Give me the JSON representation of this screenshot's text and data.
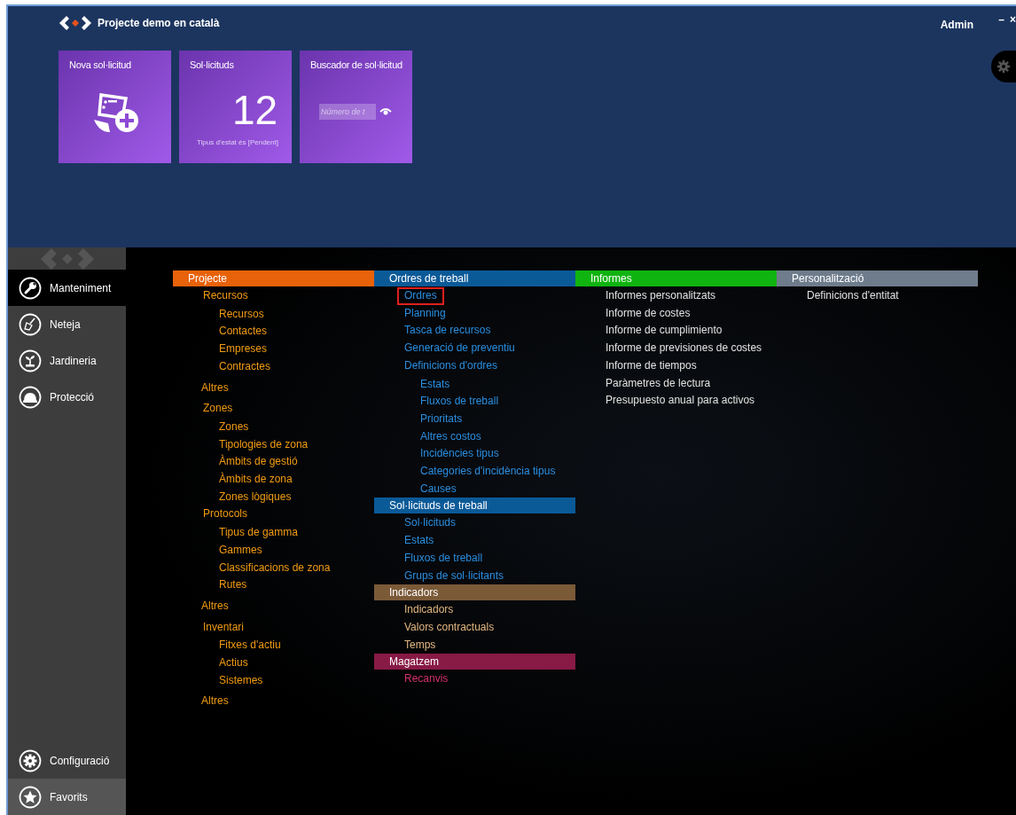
{
  "header": {
    "title": "Projecte demo en català",
    "user": "Admin",
    "window_controls": [
      "–",
      "×"
    ]
  },
  "tiles": [
    {
      "kind": "action",
      "title": "Nova sol·licitud"
    },
    {
      "kind": "counter",
      "title": "Sol·licituds",
      "count": "12",
      "caption": "Tipus d'estat és [Pendent]"
    },
    {
      "kind": "search",
      "title": "Buscador de sol·licitud",
      "placeholder": "Número de t"
    }
  ],
  "sidebar": {
    "items": [
      {
        "label": "Manteniment",
        "selected": true
      },
      {
        "label": "Neteja",
        "selected": false
      },
      {
        "label": "Jardineria",
        "selected": false
      },
      {
        "label": "Protecció",
        "selected": false
      }
    ],
    "bottom_items": [
      {
        "label": "Configuració",
        "hovered": false
      },
      {
        "label": "Favorits",
        "hovered": true
      }
    ]
  },
  "menu_columns": [
    {
      "sections": [
        {
          "title": "Projecte",
          "color": "#e8620a",
          "kind": "project",
          "items": [
            {
              "label": "Recursos",
              "kind": "link",
              "selected": false,
              "children": [
                {
                  "label": "Recursos",
                  "kind": "link",
                  "selected": false
                },
                {
                  "label": "Contactes",
                  "kind": "link",
                  "selected": false
                },
                {
                  "label": "Empreses",
                  "kind": "link",
                  "selected": false
                },
                {
                  "label": "Contractes",
                  "kind": "link",
                  "selected": false
                },
                {
                  "label": "Altres",
                  "kind": "more",
                  "selected": false
                }
              ]
            },
            {
              "label": "Zones",
              "kind": "link",
              "selected": false,
              "children": [
                {
                  "label": "Zones",
                  "kind": "link",
                  "selected": false
                },
                {
                  "label": "Tipologies de zona",
                  "kind": "link",
                  "selected": false
                },
                {
                  "label": "Àmbits de gestió",
                  "kind": "link",
                  "selected": false
                },
                {
                  "label": "Àmbits de zona",
                  "kind": "link",
                  "selected": false
                },
                {
                  "label": "Zones lògiques",
                  "kind": "link",
                  "selected": false
                }
              ]
            },
            {
              "label": "Protocols",
              "kind": "link",
              "selected": false,
              "children": [
                {
                  "label": "Tipus de gamma",
                  "kind": "link",
                  "selected": false
                },
                {
                  "label": "Gammes",
                  "kind": "link",
                  "selected": false
                },
                {
                  "label": "Classificacions de zona",
                  "kind": "link",
                  "selected": false
                },
                {
                  "label": "Rutes",
                  "kind": "link",
                  "selected": false
                },
                {
                  "label": "Altres",
                  "kind": "more",
                  "selected": false
                }
              ]
            },
            {
              "label": "Inventari",
              "kind": "link",
              "selected": false,
              "children": [
                {
                  "label": "Fitxes d'actiu",
                  "kind": "link",
                  "selected": false
                },
                {
                  "label": "Actius",
                  "kind": "link",
                  "selected": false
                },
                {
                  "label": "Sistemes",
                  "kind": "link",
                  "selected": false
                },
                {
                  "label": "Altres",
                  "kind": "more",
                  "selected": false
                }
              ]
            }
          ]
        }
      ]
    },
    {
      "sections": [
        {
          "title": "Ordres de treball",
          "color": "#0b5a98",
          "kind": "work",
          "items": [
            {
              "label": "Ordres",
              "kind": "link",
              "selected": true
            },
            {
              "label": "Planning",
              "kind": "link",
              "selected": false
            },
            {
              "label": "Tasca de recursos",
              "kind": "link",
              "selected": false
            },
            {
              "label": "Generació de preventiu",
              "kind": "link",
              "selected": false
            },
            {
              "label": "Definicions d'ordres",
              "kind": "link",
              "selected": false,
              "children": [
                {
                  "label": "Estats",
                  "kind": "link",
                  "selected": false
                },
                {
                  "label": "Fluxos de treball",
                  "kind": "link",
                  "selected": false
                },
                {
                  "label": "Prioritats",
                  "kind": "link",
                  "selected": false
                },
                {
                  "label": "Altres costos",
                  "kind": "link",
                  "selected": false
                },
                {
                  "label": "Incidències tipus",
                  "kind": "link",
                  "selected": false
                },
                {
                  "label": "Categories d'incidència tipus",
                  "kind": "link",
                  "selected": false
                },
                {
                  "label": "Causes",
                  "kind": "link",
                  "selected": false
                }
              ]
            }
          ]
        },
        {
          "title": "Sol·licituds de treball",
          "color": "#0b5a98",
          "kind": "work",
          "items": [
            {
              "label": "Sol·licituds",
              "kind": "link",
              "selected": false
            },
            {
              "label": "Estats",
              "kind": "link",
              "selected": false
            },
            {
              "label": "Fluxos de treball",
              "kind": "link",
              "selected": false
            },
            {
              "label": "Grups de sol·licitants",
              "kind": "link",
              "selected": false
            }
          ]
        },
        {
          "title": "Indicadors",
          "color": "#7b5a38",
          "kind": "metrics",
          "items": [
            {
              "label": "Indicadors",
              "kind": "link",
              "selected": false
            },
            {
              "label": "Valors contractuals",
              "kind": "link",
              "selected": false
            },
            {
              "label": "Temps",
              "kind": "link",
              "selected": false
            }
          ]
        },
        {
          "title": "Magatzem",
          "color": "#881a46",
          "kind": "stock",
          "items": [
            {
              "label": "Recanvis",
              "kind": "link",
              "selected": false
            }
          ]
        }
      ]
    },
    {
      "sections": [
        {
          "title": "Informes",
          "color": "#10b410",
          "kind": "report",
          "items": [
            {
              "label": "Informes personalitzats",
              "kind": "link",
              "selected": false
            },
            {
              "label": "Informe de costes",
              "kind": "link",
              "selected": false
            },
            {
              "label": "Informe de cumplimiento",
              "kind": "link",
              "selected": false
            },
            {
              "label": "Informe de previsiones de costes",
              "kind": "link",
              "selected": false
            },
            {
              "label": "Informe de tiempos",
              "kind": "link",
              "selected": false
            },
            {
              "label": "Paràmetres de lectura",
              "kind": "link",
              "selected": false
            },
            {
              "label": "Presupuesto anual para activos",
              "kind": "link",
              "selected": false
            }
          ]
        }
      ]
    },
    {
      "sections": [
        {
          "title": "Personalització",
          "color": "#6e7c8c",
          "kind": "report",
          "items": [
            {
              "label": "Definicions d'entitat",
              "kind": "link",
              "selected": false
            }
          ]
        }
      ]
    }
  ]
}
